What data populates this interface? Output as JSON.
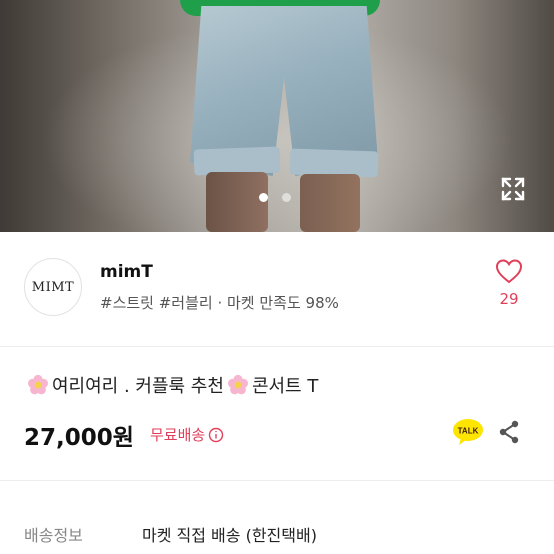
{
  "photo": {
    "pagination": {
      "count": 2,
      "active_index": 0
    }
  },
  "seller": {
    "logo_text": "MIMT",
    "name": "mimT",
    "tags_line": "#스트릿 #러블리 · 마켓 만족도 98%",
    "like_count": "29"
  },
  "product": {
    "title_part1": "여리여리 . 커플룩 추천",
    "title_part2": "콘서트 T",
    "price": "27,000원",
    "shipping_label": "무료배송"
  },
  "kakao": {
    "badge_text": "TALK"
  },
  "delivery": {
    "label": "배송정보",
    "value": "마켓 직접 배송 (한진택배)"
  },
  "colors": {
    "accent": "#e0405a",
    "shirt_green": "#1f9f4a",
    "kakao_yellow": "#fee500"
  },
  "icons": [
    "expand-icon",
    "heart-icon",
    "flower-emoji-icon",
    "info-icon",
    "kakao-talk-icon",
    "share-icon"
  ]
}
